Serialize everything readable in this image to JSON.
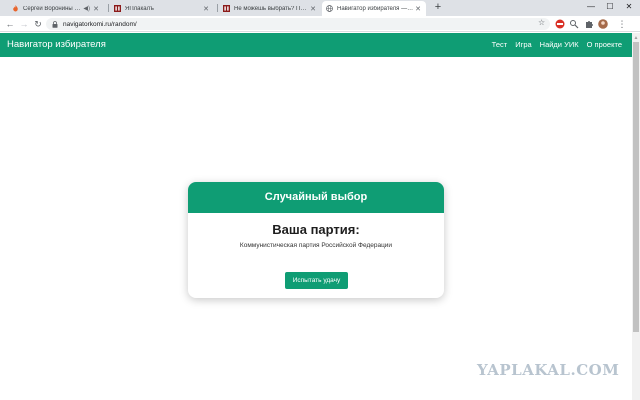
{
  "browser": {
    "tabs": [
      {
        "title": "Сергей Воронины смотрит...",
        "icon": "flame-icon"
      },
      {
        "title": "ЯПлакалъ",
        "icon": "yaplakal-icon"
      },
      {
        "title": "Не можешь выбрать? Пройди...",
        "icon": "yaplakal-icon"
      },
      {
        "title": "Навигатор избирателя — Слу...",
        "icon": "globe-icon"
      }
    ],
    "new_tab": "+",
    "window_controls": {
      "minimize": "—",
      "maximize": "☐",
      "close": "✕"
    },
    "address": "navigatorkomi.ru/random/"
  },
  "site": {
    "brand": "Навигатор избирателя",
    "menu": [
      "Тест",
      "Игра",
      "Найди УИК",
      "О проекте"
    ]
  },
  "card": {
    "header": "Случайный выбор",
    "heading": "Ваша партия:",
    "party": "Коммунистическая партия Российской Федерации",
    "button": "Испытать удачу"
  },
  "watermark": "YAPLAKAL.COM",
  "colors": {
    "accent": "#0f9d74",
    "tabstrip": "#dee1e6"
  }
}
